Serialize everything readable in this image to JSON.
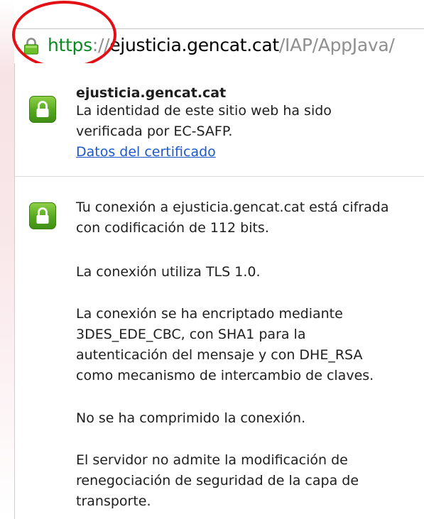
{
  "url": {
    "scheme": "https",
    "separator": "://",
    "host": "ejusticia.gencat.cat",
    "path": "/IAP/AppJava/"
  },
  "identity": {
    "site": "ejusticia.gencat.cat",
    "verification_lines": [
      "La identidad de este sitio web ha sido",
      "verificada por EC-SAFP."
    ],
    "certificate_link": "Datos del certificado"
  },
  "connection": {
    "encryption_lines": [
      "Tu conexión a ejusticia.gencat.cat está cifrada",
      "con codificación de 112 bits."
    ],
    "protocol_line": "La conexión utiliza TLS 1.0.",
    "cipher_lines": [
      "La conexión se ha encriptado mediante",
      "3DES_EDE_CBC, con SHA1 para la",
      "autenticación del mensaje y con DHE_RSA",
      "como mecanismo de intercambio de claves."
    ],
    "compression_line": "No se ha comprimido la conexión.",
    "renegotiation_lines": [
      "El servidor no admite la modificación de",
      "renegociación de seguridad de la capa de",
      "transporte."
    ]
  },
  "colors": {
    "scheme_green": "#0b8a22",
    "lock_green": "#55a820",
    "link_blue": "#1c58c9",
    "highlight_red": "#e20f14"
  }
}
